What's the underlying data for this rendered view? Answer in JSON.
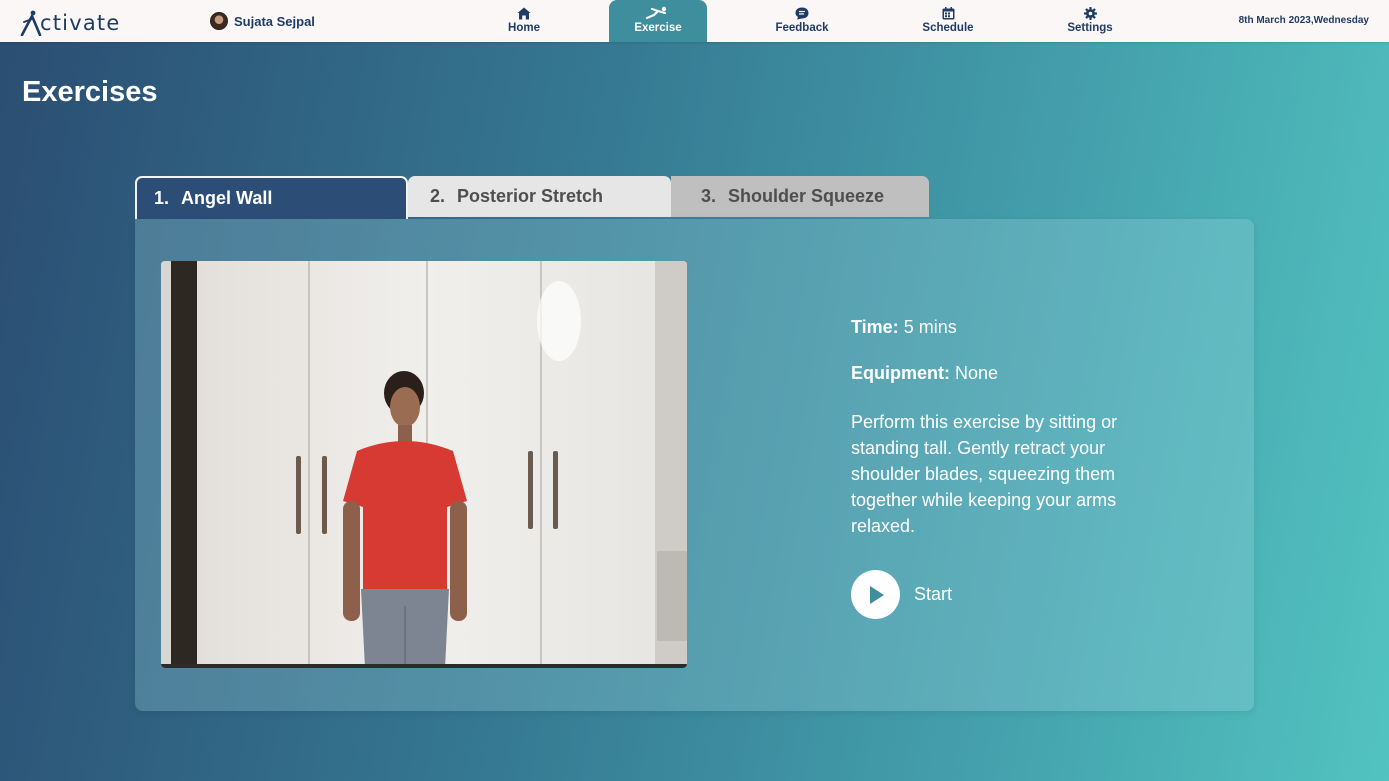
{
  "app": {
    "name": "ctivate"
  },
  "user": {
    "name": "Sujata Sejpal"
  },
  "nav": {
    "items": [
      {
        "label": "Home",
        "icon": "home-icon"
      },
      {
        "label": "Exercise",
        "icon": "exercise-icon",
        "active": true
      },
      {
        "label": "Feedback",
        "icon": "feedback-icon"
      },
      {
        "label": "Schedule",
        "icon": "calendar-icon"
      },
      {
        "label": "Settings",
        "icon": "gear-icon"
      }
    ]
  },
  "date": "8th March 2023,Wednesday",
  "page": {
    "title": "Exercises"
  },
  "tabs": [
    {
      "number": "1.",
      "label": "Angel Wall",
      "active": true
    },
    {
      "number": "2.",
      "label": "Posterior Stretch"
    },
    {
      "number": "3.",
      "label": "Shoulder Squeeze"
    }
  ],
  "exercise": {
    "time_label": "Time:",
    "time_value": "5 mins",
    "equipment_label": "Equipment:",
    "equipment_value": "None",
    "description": "Perform this exercise by sitting or standing tall. Gently retract your shoulder blades, squeezing them together while keeping your arms relaxed.",
    "start_label": "Start"
  },
  "colors": {
    "nav_text": "#1f3c66",
    "active_nav_bg": "#3f8e9d",
    "active_tab_bg": "#2c4e76",
    "background_start": "#2b4d72",
    "background_end": "#52c3c0"
  }
}
